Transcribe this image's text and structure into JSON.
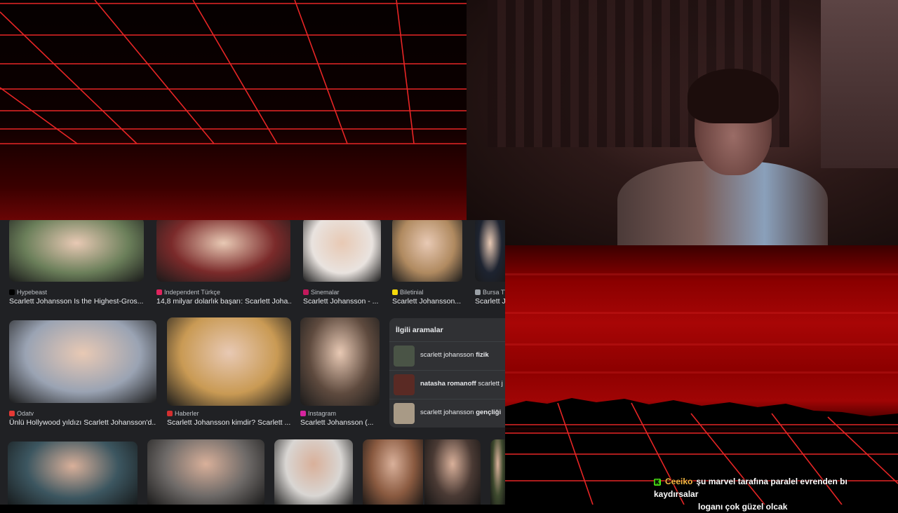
{
  "image_results": {
    "row1": [
      {
        "source": "Hypebeast",
        "title": "Scarlett Johansson Is the Highest-Gros...",
        "thumb_color": "#6b7f5a",
        "favicon_color": "#000000"
      },
      {
        "source": "Independent Türkçe",
        "title": "14,8 milyar dolarlık başarı: Scarlett Joha...",
        "thumb_color": "#7a2a2a",
        "favicon_color": "#e0245e"
      },
      {
        "source": "Sinemalar",
        "title": "Scarlett Johansson - ...",
        "thumb_color": "#e9e3df",
        "favicon_color": "#c2185b"
      },
      {
        "source": "Biletinial",
        "title": "Scarlett Johansson...",
        "thumb_color": "#b08a60",
        "favicon_color": "#f5d90a"
      },
      {
        "source": "Bursa TV",
        "title": "Scarlett Jo",
        "thumb_color": "#1d2330",
        "favicon_color": "#9aa0a6"
      }
    ],
    "row2": [
      {
        "source": "Odatv",
        "title": "Ünlü Hollywood yıldızı Scarlett Johansson'd...",
        "thumb_color": "#9aa3b3",
        "favicon_color": "#e53935"
      },
      {
        "source": "Haberler",
        "title": "Scarlett Johansson kimdir? Scarlett ...",
        "thumb_color": "#c99a54",
        "favicon_color": "#d32f2f"
      },
      {
        "source": "Instagram",
        "title": "Scarlett Johansson (...",
        "thumb_color": "#5e4a3e",
        "favicon_color": "#d6249f"
      }
    ],
    "row3": [
      {
        "thumb_color": "#3c5660"
      },
      {
        "thumb_color": "#6e6a68"
      },
      {
        "thumb_color": "#d9d6d3"
      },
      {
        "thumb_color": "#8a5a40"
      },
      {
        "thumb_color": "#4a3a34"
      },
      {
        "thumb_color": "#3e4a2e"
      }
    ]
  },
  "related_searches": {
    "title": "İlgili aramalar",
    "items": [
      {
        "prefix": "scarlett johansson ",
        "bold": "fizik",
        "suffix": "",
        "thumb_color": "#4a5446"
      },
      {
        "prefix": "",
        "bold": "natasha romanoff",
        "suffix": " scarlett j",
        "thumb_color": "#5a2a24"
      },
      {
        "prefix": "scarlett johansson ",
        "bold": "gençliği",
        "suffix": "",
        "thumb_color": "#a89a86"
      }
    ]
  },
  "chat": {
    "badge": "K",
    "username": "Ceeiko",
    "line1": "şu marvel tarafına paralel evrenden bı kaydırsalar",
    "line2": "loganı çok güzel olcak",
    "badge_color": "#53fc18",
    "username_color": "#f5b942"
  },
  "colors": {
    "overlay_red": "#a80606",
    "grid_line": "#ff2a2a",
    "browser_bg": "#202124"
  }
}
